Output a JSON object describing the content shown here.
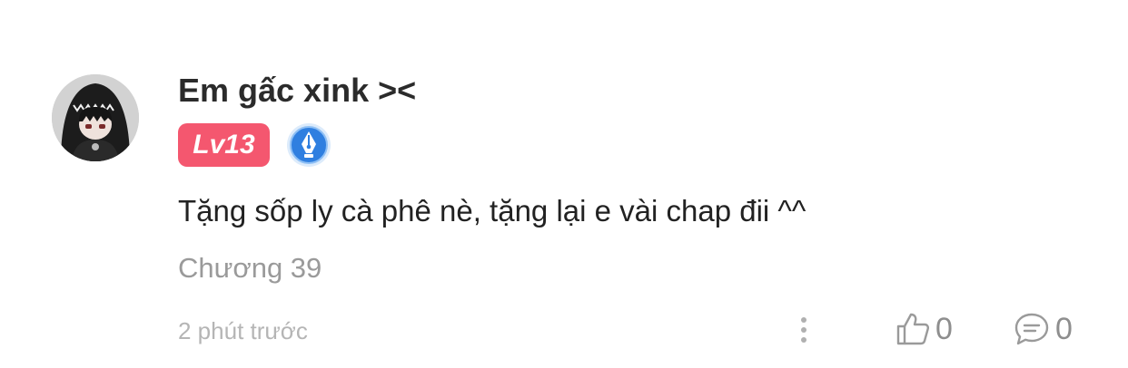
{
  "user": {
    "name": "Em gấc xink ><",
    "level": "Lv13",
    "avatar_icon": "avatar-image",
    "badge_icon": "pen-nib-badge-icon"
  },
  "comment": {
    "text": "Tặng sốp ly cà phê nè, tặng lại e vài chap đii ^^",
    "chapter": "Chương 39",
    "time": "2 phút trước"
  },
  "actions": {
    "more_icon": "more-vertical-icon",
    "like_icon": "thumbs-up-icon",
    "like_count": "0",
    "reply_icon": "chat-bubble-icon",
    "reply_count": "0"
  },
  "colors": {
    "level_badge": "#f4576f",
    "badge_blue": "#2f7fe0",
    "text_primary": "#222222",
    "text_muted": "#9a9a9a"
  }
}
